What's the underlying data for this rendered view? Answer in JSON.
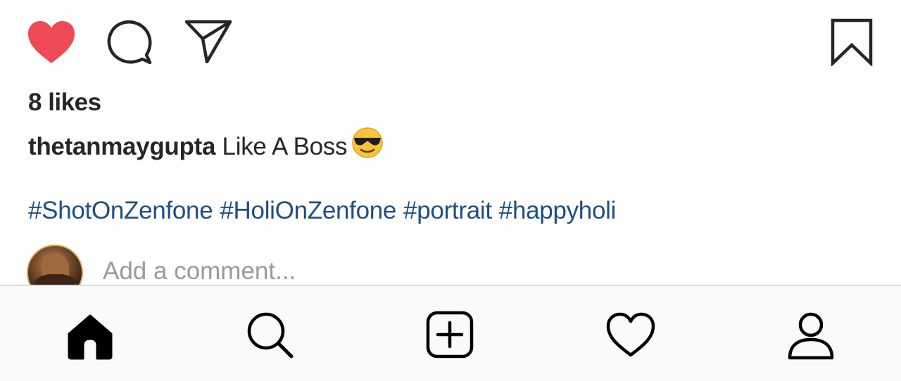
{
  "post": {
    "actions": {
      "like_icon": "heart-filled-icon",
      "comment_icon": "comment-bubble-icon",
      "share_icon": "paper-plane-icon",
      "save_icon": "bookmark-icon",
      "like_color": "#ed4956"
    },
    "likes_text": "8 likes",
    "caption": {
      "username": "thetanmaygupta",
      "text": " Like A Boss",
      "emoji": "smiling-face-with-sunglasses"
    },
    "hashtags": [
      "#ShotOnZenfone",
      "#HoliOnZenfone",
      "#portrait",
      "#happyholi"
    ],
    "hashtag_color": "#1d4f80",
    "comment": {
      "placeholder": "Add a comment..."
    }
  },
  "bottom_nav": {
    "items": [
      {
        "icon": "home-icon",
        "active": true
      },
      {
        "icon": "search-icon",
        "active": false
      },
      {
        "icon": "new-post-icon",
        "active": false
      },
      {
        "icon": "activity-heart-icon",
        "active": false
      },
      {
        "icon": "profile-icon",
        "active": false
      }
    ]
  }
}
